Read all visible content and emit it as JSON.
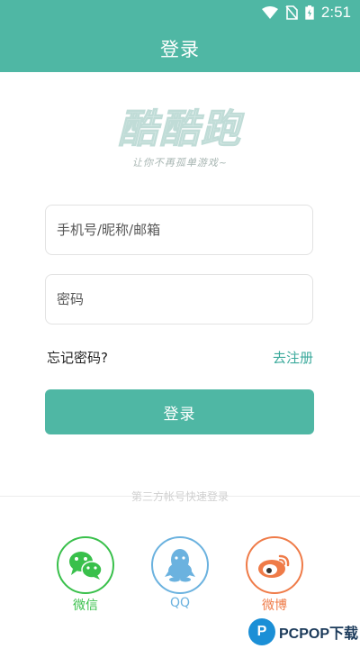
{
  "status_bar": {
    "time": "2:51"
  },
  "app_bar": {
    "title": "登录"
  },
  "logo": {
    "title": "酷酷跑",
    "slogan": "让你不再孤单游戏~"
  },
  "form": {
    "account_placeholder": "手机号/昵称/邮箱",
    "password_placeholder": "密码",
    "forgot_label": "忘记密码?",
    "register_label": "去注册",
    "login_button": "登录"
  },
  "third_party": {
    "label": "第三方帐号快速登录",
    "providers": [
      {
        "label": "微信",
        "icon": "wechat-icon",
        "color": "#39c04b"
      },
      {
        "label": "QQ",
        "icon": "qq-icon",
        "color": "#6bb2df"
      },
      {
        "label": "微博",
        "icon": "weibo-icon",
        "color": "#ef7b48"
      }
    ]
  },
  "watermark": {
    "text": "PCPOP下载"
  },
  "colors": {
    "primary": "#4fb7a4",
    "link": "#3aa99b"
  }
}
